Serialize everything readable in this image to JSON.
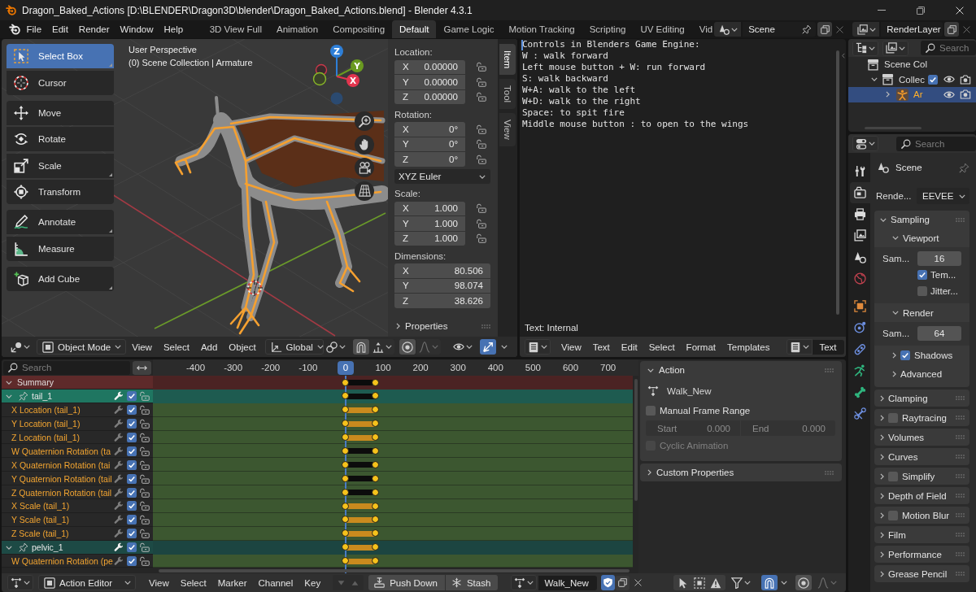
{
  "window": {
    "title": "Dragon_Baked_Actions [D:\\BLENDER\\Dragon3D\\blender\\Dragon_Baked_Actions.blend] - Blender 4.3.1"
  },
  "menu": [
    "File",
    "Edit",
    "Render",
    "Window",
    "Help"
  ],
  "workspaces": [
    {
      "label": "3D View Full",
      "selected": false
    },
    {
      "label": "Animation",
      "selected": false
    },
    {
      "label": "Compositing",
      "selected": false
    },
    {
      "label": "Default",
      "selected": true
    },
    {
      "label": "Game Logic",
      "selected": false
    },
    {
      "label": "Motion Tracking",
      "selected": false
    },
    {
      "label": "Scripting",
      "selected": false
    },
    {
      "label": "UV Editing",
      "selected": false
    },
    {
      "label": "Vid",
      "selected": false
    }
  ],
  "scene": {
    "value": "Scene"
  },
  "view_layer": {
    "value": "RenderLayer"
  },
  "viewport": {
    "tool_groups": [
      [
        {
          "label": "Select Box",
          "selected": true,
          "variants": true
        },
        {
          "label": "Cursor",
          "selected": false,
          "variants": false
        }
      ],
      [
        {
          "label": "Move",
          "selected": false,
          "variants": false
        },
        {
          "label": "Rotate",
          "selected": false,
          "variants": false
        },
        {
          "label": "Scale",
          "selected": false,
          "variants": true
        },
        {
          "label": "Transform",
          "selected": false,
          "variants": false
        }
      ],
      [
        {
          "label": "Annotate",
          "selected": false,
          "variants": true
        },
        {
          "label": "Measure",
          "selected": false,
          "variants": false
        }
      ],
      [
        {
          "label": "Add Cube",
          "selected": false,
          "variants": true
        }
      ]
    ],
    "info": [
      "User Perspective",
      "(0) Scene Collection | Armature"
    ],
    "gizmo_axes": [
      {
        "kind": "z",
        "label": "Z"
      },
      {
        "kind": "y",
        "label": "Y"
      },
      {
        "kind": "x",
        "label": "X"
      }
    ],
    "sidebar": {
      "sections": [
        {
          "kind": "fields",
          "title": "Location:",
          "fields": [
            {
              "axis": "X",
              "value": "0.00000",
              "locked": false
            },
            {
              "axis": "Y",
              "value": "0.00000",
              "locked": false
            },
            {
              "axis": "Z",
              "value": "0.00000",
              "locked": false
            }
          ]
        },
        {
          "kind": "fields",
          "title": "Rotation:",
          "fields": [
            {
              "axis": "X",
              "value": "0°",
              "locked": false
            },
            {
              "axis": "Y",
              "value": "0°",
              "locked": false
            },
            {
              "axis": "Z",
              "value": "0°",
              "locked": false
            }
          ]
        },
        {
          "kind": "dropdown",
          "value": "XYZ Euler"
        },
        {
          "kind": "fields",
          "title": "Scale:",
          "fields": [
            {
              "axis": "X",
              "value": "1.000",
              "locked": false
            },
            {
              "axis": "Y",
              "value": "1.000",
              "locked": false
            },
            {
              "axis": "Z",
              "value": "1.000",
              "locked": false
            }
          ]
        },
        {
          "kind": "fields",
          "title": "Dimensions:",
          "fields": [
            {
              "axis": "X",
              "value": "80.506"
            },
            {
              "axis": "Y",
              "value": "98.074"
            },
            {
              "axis": "Z",
              "value": "38.626"
            }
          ]
        }
      ],
      "properties": {
        "label": "Properties",
        "expanded": false
      }
    },
    "sidebar_tabs": [
      {
        "label": "Item",
        "selected": true
      },
      {
        "label": "Tool",
        "selected": false
      },
      {
        "label": "View",
        "selected": false
      }
    ],
    "header": {
      "mode": "Object Mode",
      "menus": [
        "View",
        "Select",
        "Add",
        "Object"
      ],
      "orientation": "Global",
      "snapping": false,
      "proportional": false,
      "gizmos": true
    }
  },
  "text_editor": {
    "lines": [
      "Controls in Blenders Game Engine:",
      "W : walk forward",
      "Left mouse button + W: run forward",
      "S: walk backward",
      "W+A: walk to the left",
      "W+D: walk to the right",
      "Space: to spit fire",
      "Middle mouse button : to open to the wings"
    ],
    "status": "Text: Internal",
    "menus": [
      "View",
      "Text",
      "Edit",
      "Select",
      "Format",
      "Templates"
    ],
    "text_name": "Text"
  },
  "outliner": {
    "search": {
      "placeholder": "Search"
    },
    "tree": [
      {
        "label": "Scene Col",
        "kind": "scene_collection",
        "selected": false,
        "children": [
          {
            "label": "Collec",
            "kind": "collection",
            "expanded": true,
            "checked": true,
            "visible": true,
            "renderable": true,
            "selected": false,
            "children": [
              {
                "label": "Ar",
                "kind": "armature",
                "expanded": false,
                "visible": true,
                "renderable": true,
                "selected": true
              }
            ]
          }
        ]
      }
    ]
  },
  "properties": {
    "search": {
      "placeholder": "Search"
    },
    "tabs": [
      {
        "selected": false
      },
      {
        "selected": true
      },
      {
        "selected": false
      },
      {
        "selected": false
      },
      {
        "selected": false
      },
      {
        "selected": false
      },
      {
        "selected": false
      },
      {
        "selected": false
      },
      {
        "selected": false
      },
      {
        "selected": false
      },
      {
        "selected": false
      },
      {
        "selected": false
      }
    ],
    "context": "Scene",
    "engine": {
      "label": "Rende...",
      "value": "EEVEE"
    },
    "panels": [
      {
        "label": "Sampling",
        "expanded": true,
        "subpanels": [
          {
            "label": "Viewport",
            "expanded": true,
            "rows": [
              {
                "kind": "number",
                "label": "Sam...",
                "value": "16"
              },
              {
                "kind": "checkbox",
                "label": "Tem...",
                "checked": true
              },
              {
                "kind": "checkbox",
                "label": "Jitter...",
                "checked": false
              }
            ]
          },
          {
            "label": "Render",
            "expanded": true,
            "rows": [
              {
                "kind": "number",
                "label": "Sam...",
                "value": "64"
              }
            ]
          },
          {
            "label": "Shadows",
            "expanded": false,
            "checked": true
          },
          {
            "label": "Advanced",
            "expanded": false
          }
        ]
      },
      {
        "label": "Clamping",
        "expanded": false
      },
      {
        "label": "Raytracing",
        "expanded": false,
        "checked": false
      },
      {
        "label": "Volumes",
        "expanded": false
      },
      {
        "label": "Curves",
        "expanded": false
      },
      {
        "label": "Simplify",
        "expanded": false,
        "checked": false
      },
      {
        "label": "Depth of Field",
        "expanded": false
      },
      {
        "label": "Motion Blur",
        "expanded": false,
        "checked": false
      },
      {
        "label": "Film",
        "expanded": false
      },
      {
        "label": "Performance",
        "expanded": false
      },
      {
        "label": "Grease Pencil",
        "expanded": false
      }
    ]
  },
  "dope_sheet": {
    "search": {
      "placeholder": "Search"
    },
    "ruler": [
      {
        "kind": "tick",
        "label": "-400"
      },
      {
        "kind": "tick",
        "label": "-300"
      },
      {
        "kind": "tick",
        "label": "-200"
      },
      {
        "kind": "tick",
        "label": "-100"
      },
      {
        "kind": "current",
        "label": "0"
      },
      {
        "kind": "tick",
        "label": "100"
      },
      {
        "kind": "tick",
        "label": "200"
      },
      {
        "kind": "tick",
        "label": "300"
      },
      {
        "kind": "tick",
        "label": "400"
      },
      {
        "kind": "tick",
        "label": "500"
      },
      {
        "kind": "tick",
        "label": "600"
      },
      {
        "kind": "tick",
        "label": "700"
      }
    ],
    "channels": [
      {
        "kind": "summary",
        "label": "Summary",
        "expanded": true,
        "selected": false,
        "hold": false
      },
      {
        "kind": "group",
        "label": "tail_1",
        "expanded": true,
        "selected": true,
        "checked": true,
        "locked": false,
        "hold": false
      },
      {
        "kind": "channel",
        "label": "X Location (tail_1)",
        "selected": true,
        "checked": true,
        "locked": false,
        "hold": true
      },
      {
        "kind": "channel",
        "label": "Y Location (tail_1)",
        "selected": true,
        "checked": true,
        "locked": false,
        "hold": true
      },
      {
        "kind": "channel",
        "label": "Z Location (tail_1)",
        "selected": true,
        "checked": true,
        "locked": false,
        "hold": true
      },
      {
        "kind": "channel",
        "label": "W Quaternion Rotation (ta",
        "selected": true,
        "checked": true,
        "locked": false,
        "hold": false
      },
      {
        "kind": "channel",
        "label": "X Quaternion Rotation (tai",
        "selected": true,
        "checked": true,
        "locked": false,
        "hold": false
      },
      {
        "kind": "channel",
        "label": "Y Quaternion Rotation (tail",
        "selected": true,
        "checked": true,
        "locked": false,
        "hold": false
      },
      {
        "kind": "channel",
        "label": "Z Quaternion Rotation (tail",
        "selected": true,
        "checked": true,
        "locked": false,
        "hold": false
      },
      {
        "kind": "channel",
        "label": "X Scale (tail_1)",
        "selected": true,
        "checked": true,
        "locked": false,
        "hold": true
      },
      {
        "kind": "channel",
        "label": "Y Scale (tail_1)",
        "selected": true,
        "checked": true,
        "locked": false,
        "hold": true
      },
      {
        "kind": "channel",
        "label": "Z Scale (tail_1)",
        "selected": true,
        "checked": true,
        "locked": false,
        "hold": true
      },
      {
        "kind": "group",
        "label": "pelvic_1",
        "expanded": true,
        "selected": false,
        "checked": true,
        "locked": false,
        "hold": true
      },
      {
        "kind": "channel",
        "label": "W Quaternion Rotation (pe",
        "selected": true,
        "checked": true,
        "locked": false,
        "hold": true
      }
    ],
    "action_panel": {
      "label": "Action",
      "expanded": true,
      "action": "Walk_New",
      "manual_range": {
        "label": "Manual Frame Range",
        "checked": false
      },
      "range": [
        {
          "label": "Start",
          "value": "0.000",
          "disabled": true
        },
        {
          "label": "End",
          "value": "0.000",
          "disabled": true
        }
      ],
      "cyclic": {
        "label": "Cyclic Animation",
        "checked": false,
        "disabled": true
      }
    },
    "custom_panel": {
      "label": "Custom Properties",
      "expanded": false
    },
    "header": {
      "mode": "Action Editor",
      "menus": [
        "View",
        "Select",
        "Marker",
        "Channel",
        "Key"
      ],
      "buttons": [
        "Push Down",
        "Stash"
      ],
      "action": "Walk_New",
      "fake_user": true,
      "snapping": true,
      "proportional": false
    }
  }
}
